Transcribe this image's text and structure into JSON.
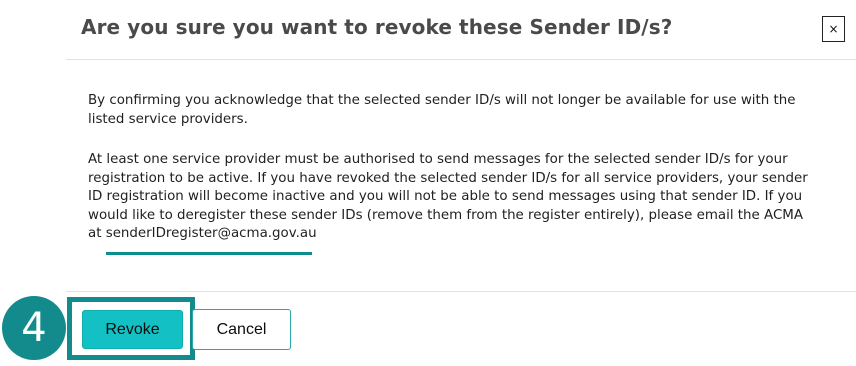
{
  "dialog": {
    "title": "Are you sure you want to revoke these Sender ID/s?",
    "close_label": "×",
    "paragraph1": "By confirming you acknowledge that the selected sender ID/s will not longer be available for use with the listed service providers.",
    "paragraph2_text": "At least one service provider must be authorised to send messages for the selected sender ID/s for your registration to be active. If you have revoked the selected  sender ID/s for all service providers, your sender ID registration will become inactive and you will not be able to send messages using that sender ID. If you would like to deregister these sender IDs (remove them from the register entirely), please email the ACMA at ",
    "email": "senderIDregister@acma.gov.au",
    "revoke_label": "Revoke",
    "cancel_label": "Cancel"
  },
  "annotation": {
    "step_number": "4",
    "color": "#138b8c"
  },
  "colors": {
    "accent": "#13c1c4",
    "cancel_border": "#2aa8aa",
    "title": "#4a4a4a"
  }
}
